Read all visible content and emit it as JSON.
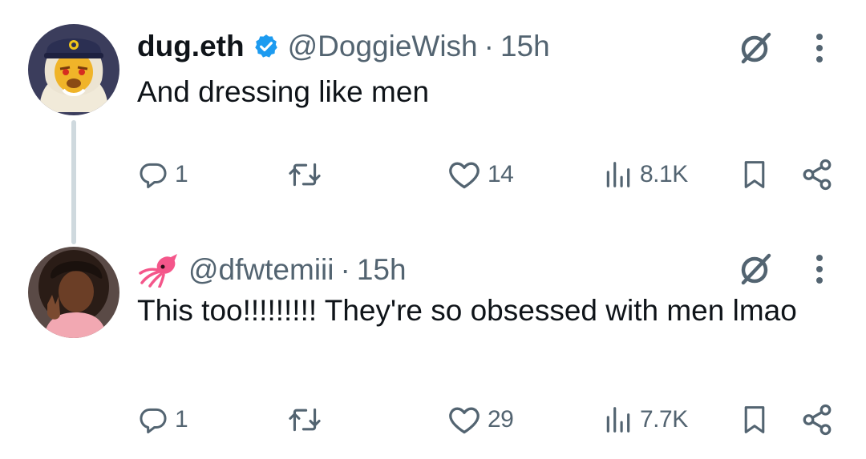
{
  "tweets": [
    {
      "display_name": "dug.eth",
      "verified": true,
      "handle": "@DoggieWish",
      "separator": "·",
      "time": "15h",
      "text": "And dressing like men",
      "avatar_icon": "lion-captain-avatar",
      "stats": {
        "replies": "1",
        "reposts": "",
        "likes": "14",
        "views": "8.1K"
      }
    },
    {
      "display_name": "",
      "name_emoji": "squid-emoji",
      "handle": "@dfwtemiii",
      "separator": "·",
      "time": "15h",
      "text": "This too!!!!!!!!! They're so obsessed with men lmao",
      "avatar_icon": "woman-peace-sign-avatar",
      "stats": {
        "replies": "1",
        "reposts": "",
        "likes": "29",
        "views": "7.7K"
      }
    }
  ],
  "colors": {
    "text_primary": "#0f1419",
    "text_secondary": "#536471",
    "verified_blue": "#1d9bf0",
    "thread_line": "#cfd9de"
  }
}
